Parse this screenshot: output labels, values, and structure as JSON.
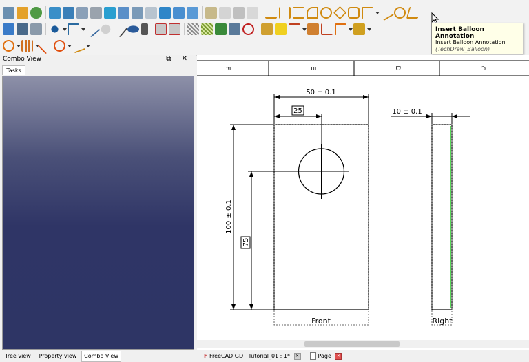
{
  "tooltip": {
    "title": "Insert Balloon Annotation",
    "description": "Insert Balloon Annotation",
    "command": "(TechDraw_Balloon)"
  },
  "combo_view": {
    "title": "Combo View",
    "controls": "⧉ ✕",
    "tab": "Tasks"
  },
  "drawing": {
    "border_letters": [
      "F",
      "E",
      "D",
      "C"
    ],
    "dimensions": {
      "width": "50 ± 0.1",
      "hole_x": "25",
      "height": "100 ± 0.1",
      "hole_y": "75",
      "thickness": "10 ± 0.1"
    },
    "views": {
      "front": "Front",
      "right": "Right"
    }
  },
  "bottom_tabs": {
    "tree": "Tree view",
    "property": "Property view",
    "combo": "Combo View"
  },
  "document_tabs": {
    "doc": "FreeCAD GDT Tutorial_01 : 1*",
    "page": "Page"
  },
  "icons": [
    "close-icon",
    "float-icon",
    "balloon-icon",
    "dimension-icon",
    "mouse-cursor-icon"
  ],
  "colors": {
    "task_panel_top": "#8d90a8",
    "task_panel_bottom": "#2e3565",
    "right_view_edge": "#22cc22",
    "tooltip_bg": "#ffffe8"
  }
}
